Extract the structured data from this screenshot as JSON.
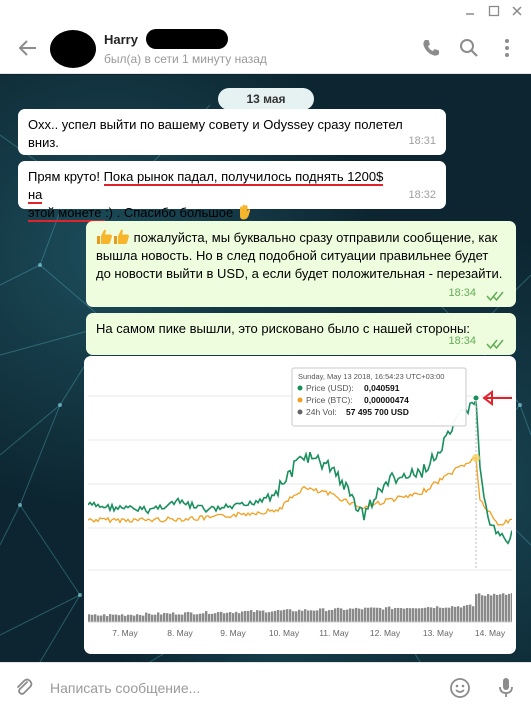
{
  "window": {
    "minimize_icon": "minimize-icon",
    "maximize_icon": "maximize-icon",
    "close_icon": "close-icon"
  },
  "header": {
    "contact_name": "Harry",
    "status": "был(а) в сети 1 минуту назад",
    "icons": [
      "back-arrow-icon",
      "phone-icon",
      "search-icon",
      "more-vertical-icon"
    ]
  },
  "chat": {
    "date_label": "13 мая",
    "messages": [
      {
        "direction": "incoming",
        "text": "Охх.. успел выйти по вашему совету и Odyssey сразу полетел вниз.",
        "time": "18:31"
      },
      {
        "direction": "incoming",
        "text_before": "Прям круто! ",
        "text_underlined_1": "Пока рынок падал, получилось поднять 1200$ на",
        "text_underlined_2": "этой монете ",
        "text_after": ":) . Спасибо большое",
        "time": "18:32"
      },
      {
        "direction": "outgoing",
        "text": "пожалуйста, мы буквально сразу отправили сообщение, как вышла новость. Но в след  подобной ситуации правильнее будет до новости выйти в USD, а если будет положительная - перезайти.",
        "time": "18:34"
      },
      {
        "direction": "outgoing",
        "text": "На самом пике вышли, это рисковано было с нашей стороны:",
        "time": "18:34"
      }
    ]
  },
  "chart_data": {
    "type": "line",
    "tooltip": {
      "datetime": "Sunday, May 13 2018, 16:54:23 UTC+03:00",
      "price_usd_label": "Price (USD):",
      "price_usd": "0,040591",
      "price_btc_label": "Price (BTC):",
      "price_btc": "0,00000474",
      "vol_label": "24h Vol:",
      "vol": "57 495 700 USD"
    },
    "x_ticks": [
      "7. May",
      "8. May",
      "9. May",
      "10. May",
      "11. May",
      "12. May",
      "13. May",
      "14. May"
    ],
    "series": [
      {
        "name": "Price (USD)",
        "color": "#1a8f5e"
      },
      {
        "name": "Price (BTC)",
        "color": "#f0a020"
      },
      {
        "name": "24h Vol",
        "color": "#666666"
      }
    ]
  },
  "input": {
    "placeholder": "Написать сообщение..."
  },
  "colors": {
    "accent_green": "#62ac55",
    "underline_red": "#e0222b"
  }
}
